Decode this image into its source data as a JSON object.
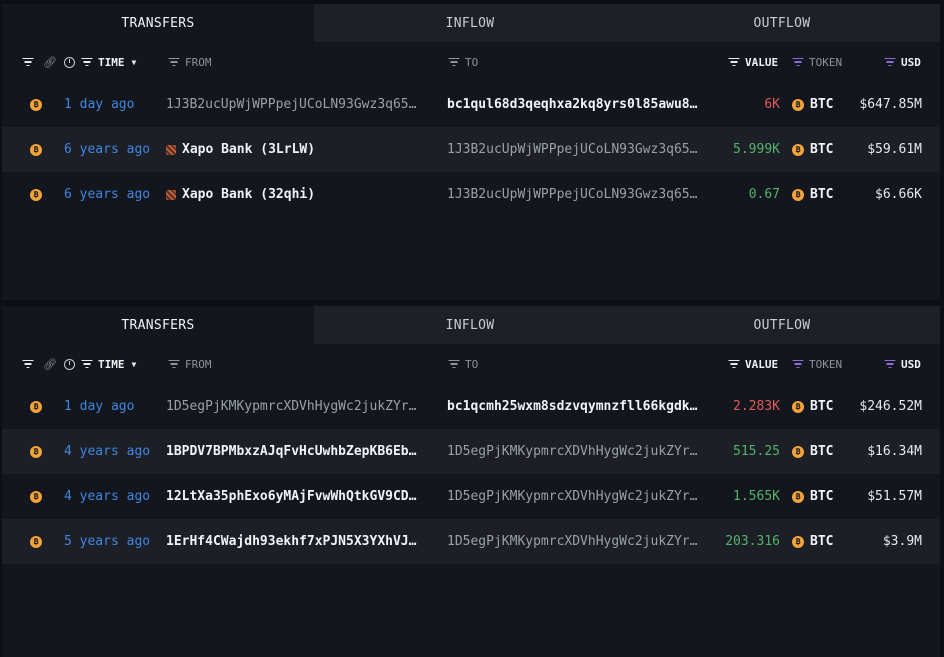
{
  "tabs": [
    "TRANSFERS",
    "INFLOW",
    "OUTFLOW"
  ],
  "headers": {
    "time": "TIME",
    "from": "FROM",
    "to": "TO",
    "value": "VALUE",
    "token": "TOKEN",
    "usd": "USD"
  },
  "colors": {
    "negative": "#e05a5a",
    "positive": "#52b46b",
    "btc": "#f3a33a",
    "time_link": "#3f86e0"
  },
  "panel1": {
    "rows": [
      {
        "time": "1 day ago",
        "from": "1J3B2ucUpWjWPPpejUCoLN93Gwz3q65…",
        "to": "bc1qul68d3qeqhxa2kq8yrs0l85awu8…",
        "value": "6K",
        "token": "BTC",
        "usd": "$647.85M"
      },
      {
        "time": "6 years ago",
        "from": "Xapo Bank (3LrLW)",
        "to": "1J3B2ucUpWjWPPpejUCoLN93Gwz3q65…",
        "value": "5.999K",
        "token": "BTC",
        "usd": "$59.61M"
      },
      {
        "time": "6 years ago",
        "from": "Xapo Bank (32qhi)",
        "to": "1J3B2ucUpWjWPPpejUCoLN93Gwz3q65…",
        "value": "0.67",
        "token": "BTC",
        "usd": "$6.66K"
      }
    ]
  },
  "panel2": {
    "rows": [
      {
        "time": "1 day ago",
        "from": "1D5egPjKMKypmrcXDVhHygWc2jukZYr…",
        "to": "bc1qcmh25wxm8sdzvqymnzfll66kgdk…",
        "value": "2.283K",
        "token": "BTC",
        "usd": "$246.52M"
      },
      {
        "time": "4 years ago",
        "from": "1BPDV7BPMbxzAJqFvHcUwhbZepKB6Eb…",
        "to": "1D5egPjKMKypmrcXDVhHygWc2jukZYr…",
        "value": "515.25",
        "token": "BTC",
        "usd": "$16.34M"
      },
      {
        "time": "4 years ago",
        "from": "12LtXa35phExo6yMAjFvwWhQtkGV9CD…",
        "to": "1D5egPjKMKypmrcXDVhHygWc2jukZYr…",
        "value": "1.565K",
        "token": "BTC",
        "usd": "$51.57M"
      },
      {
        "time": "5 years ago",
        "from": "1ErHf4CWajdh93ekhf7xPJN5X3YXhVJ…",
        "to": "1D5egPjKMKypmrcXDVhHygWc2jukZYr…",
        "value": "203.316",
        "token": "BTC",
        "usd": "$3.9M"
      }
    ]
  }
}
